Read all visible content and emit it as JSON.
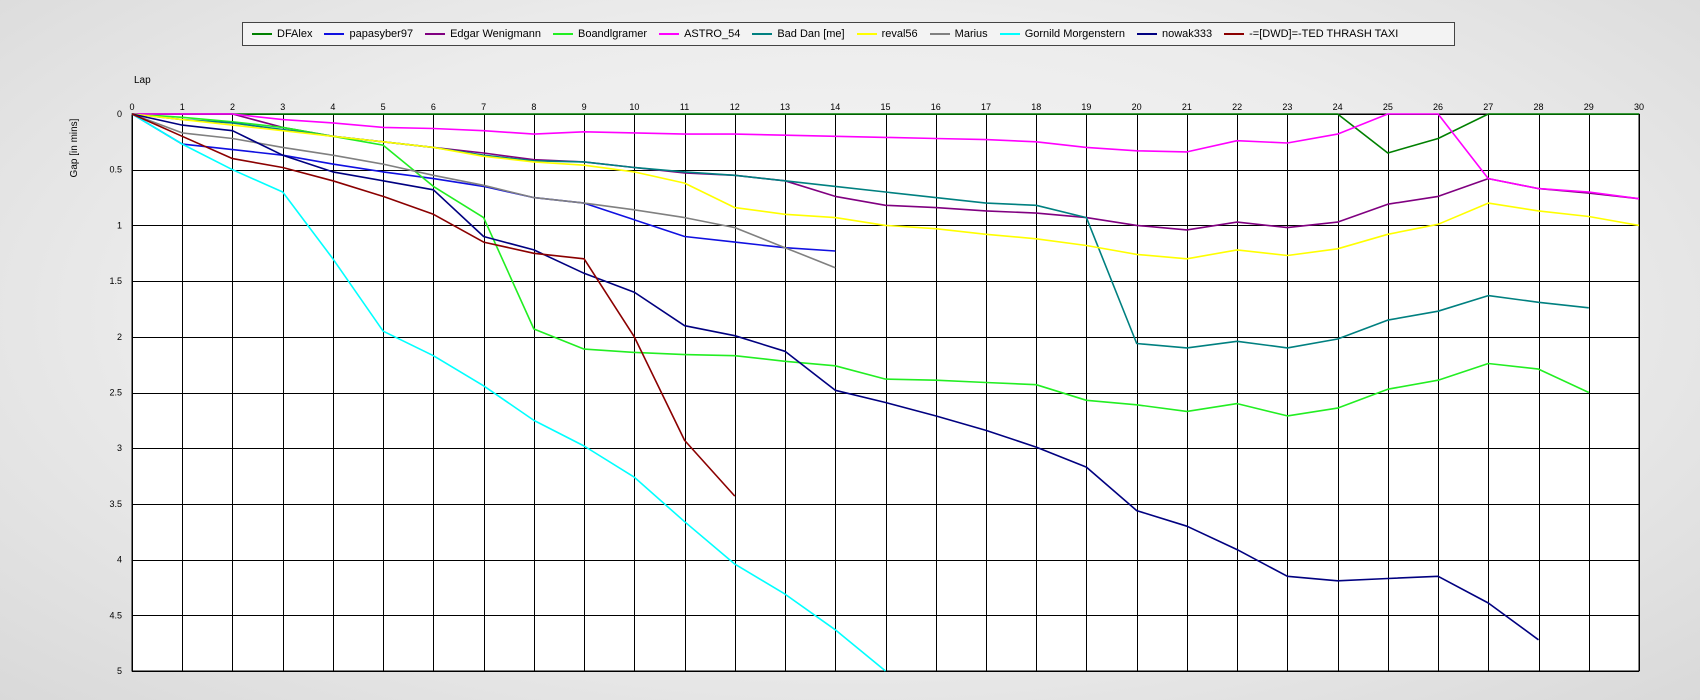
{
  "chart_data": {
    "type": "line",
    "xlabel": "Lap",
    "ylabel": "Gap [in mins]",
    "x_ticks": [
      "0",
      "1",
      "2",
      "3",
      "4",
      "5",
      "6",
      "7",
      "8",
      "9",
      "10",
      "11",
      "12",
      "13",
      "14",
      "15",
      "16",
      "17",
      "18",
      "19",
      "20",
      "21",
      "22",
      "23",
      "24",
      "25",
      "26",
      "27",
      "28",
      "29",
      "30"
    ],
    "y_ticks": [
      "0",
      "0.5",
      "1",
      "1.5",
      "2",
      "2.5",
      "3",
      "3.5",
      "4",
      "4.5",
      "5"
    ],
    "xlim": [
      0,
      30
    ],
    "ylim": [
      0,
      5
    ],
    "y_inverted": true,
    "grid": true,
    "legend_position": "top",
    "series": [
      {
        "name": "DFAlex",
        "color": "#008000",
        "values": [
          0,
          0,
          0,
          0,
          0,
          0,
          0,
          0,
          0,
          0,
          0,
          0,
          0,
          0,
          0,
          0,
          0,
          0,
          0,
          0,
          0,
          0,
          0,
          0,
          0,
          0.35,
          0.22,
          0,
          0,
          0,
          0
        ]
      },
      {
        "name": "papasyber97",
        "color": "#1010e0",
        "values": [
          0,
          0.27,
          0.32,
          0.37,
          0.45,
          0.52,
          0.58,
          0.65,
          0.75,
          0.8,
          0.95,
          1.1,
          1.15,
          1.2,
          1.23
        ]
      },
      {
        "name": "Edgar Wenigmann",
        "color": "#800080",
        "values": [
          0,
          0,
          0,
          0.12,
          0.2,
          0.25,
          0.3,
          0.35,
          0.41,
          0.43,
          0.48,
          0.53,
          0.55,
          0.6,
          0.74,
          0.82,
          0.84,
          0.87,
          0.89,
          0.93,
          1.0,
          1.04,
          0.97,
          1.02,
          0.97,
          0.81,
          0.74,
          0.58,
          0.67,
          0.71,
          0.76
        ]
      },
      {
        "name": "Boandlgramer",
        "color": "#22ee22",
        "values": [
          0,
          0.03,
          0.07,
          0.12,
          0.2,
          0.28,
          0.65,
          0.93,
          1.93,
          2.11,
          2.14,
          2.16,
          2.17,
          2.22,
          2.26,
          2.38,
          2.39,
          2.41,
          2.43,
          2.57,
          2.61,
          2.67,
          2.6,
          2.71,
          2.64,
          2.47,
          2.39,
          2.24,
          2.29,
          2.5
        ]
      },
      {
        "name": "ASTRO_54",
        "color": "#ff00ff",
        "values": [
          0,
          0,
          0,
          0.05,
          0.08,
          0.12,
          0.13,
          0.15,
          0.18,
          0.16,
          0.17,
          0.18,
          0.18,
          0.19,
          0.2,
          0.21,
          0.22,
          0.23,
          0.25,
          0.3,
          0.33,
          0.34,
          0.24,
          0.26,
          0.18,
          0,
          0,
          0.58,
          0.67,
          0.7,
          0.76
        ]
      },
      {
        "name": "Bad Dan [me]",
        "color": "#008080",
        "values": [
          0,
          0.05,
          0.08,
          0.14,
          0.2,
          0.25,
          0.3,
          0.37,
          0.42,
          0.43,
          0.48,
          0.52,
          0.55,
          0.6,
          0.65,
          0.7,
          0.75,
          0.8,
          0.82,
          0.93,
          2.06,
          2.1,
          2.04,
          2.1,
          2.02,
          1.85,
          1.77,
          1.63,
          1.69,
          1.74
        ]
      },
      {
        "name": "reval56",
        "color": "#ffff00",
        "values": [
          0,
          0.05,
          0.1,
          0.15,
          0.2,
          0.25,
          0.3,
          0.38,
          0.43,
          0.46,
          0.52,
          0.62,
          0.84,
          0.9,
          0.93,
          1.0,
          1.03,
          1.08,
          1.12,
          1.18,
          1.26,
          1.3,
          1.22,
          1.27,
          1.21,
          1.08,
          0.99,
          0.8,
          0.87,
          0.92,
          1.0
        ]
      },
      {
        "name": "Marius",
        "color": "#808080",
        "values": [
          0,
          0.17,
          0.22,
          0.3,
          0.37,
          0.45,
          0.55,
          0.64,
          0.75,
          0.8,
          0.86,
          0.93,
          1.02,
          1.2,
          1.38
        ]
      },
      {
        "name": "Gornild Morgenstern",
        "color": "#00ffff",
        "values": [
          0,
          0.27,
          0.5,
          0.7,
          1.3,
          1.95,
          2.17,
          2.44,
          2.75,
          2.98,
          3.26,
          3.66,
          4.04,
          4.31,
          4.63,
          5.0
        ]
      },
      {
        "name": "nowak333",
        "color": "#000080",
        "values": [
          0,
          0.1,
          0.15,
          0.37,
          0.52,
          0.6,
          0.68,
          1.1,
          1.22,
          1.43,
          1.6,
          1.9,
          1.99,
          2.13,
          2.48,
          2.59,
          2.71,
          2.84,
          2.99,
          3.17,
          3.56,
          3.7,
          3.91,
          4.15,
          4.19,
          4.17,
          4.15,
          4.39,
          4.72
        ]
      },
      {
        "name": "-=[DWD]=-TED THRASH TAXI",
        "color": "#8b0000",
        "values": [
          0,
          0.2,
          0.4,
          0.48,
          0.6,
          0.74,
          0.9,
          1.15,
          1.25,
          1.3,
          2.0,
          2.93,
          3.43
        ]
      }
    ]
  }
}
